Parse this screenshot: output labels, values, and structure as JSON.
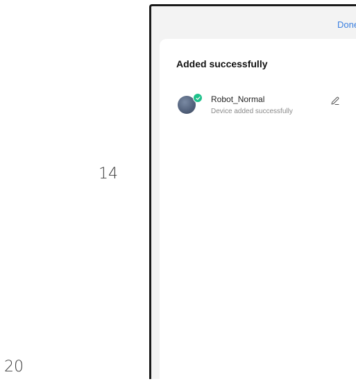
{
  "page_numbers": {
    "side": "14",
    "bottom": "20"
  },
  "header": {
    "done_label": "Done"
  },
  "card": {
    "title": "Added successfully",
    "device": {
      "name": "Robot_Normal",
      "status": "Device added successfully",
      "icon": "robot-vacuum-icon",
      "badge_icon": "check-icon"
    }
  },
  "colors": {
    "accent": "#3a7fe0",
    "success": "#1fc18b",
    "frame_background": "#f3f3f3",
    "card_background": "#ffffff"
  }
}
